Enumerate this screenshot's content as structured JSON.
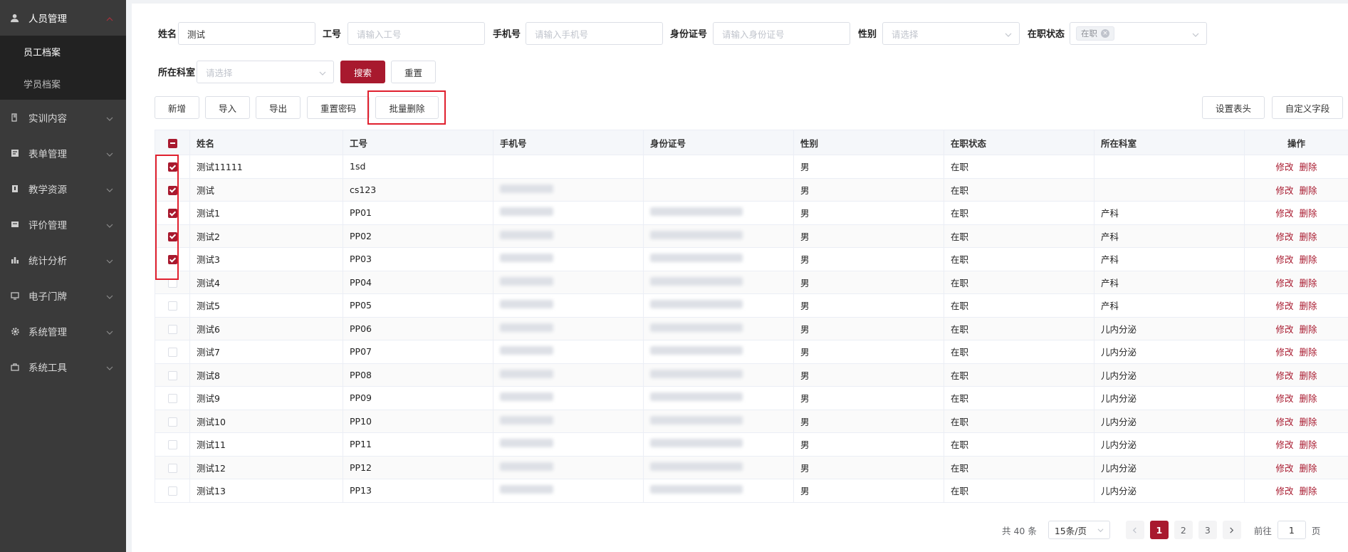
{
  "sidebar": {
    "groups": [
      {
        "label": "人员管理",
        "icon": "user-icon",
        "expanded": true
      },
      {
        "label": "实训内容",
        "icon": "book-icon"
      },
      {
        "label": "表单管理",
        "icon": "form-icon"
      },
      {
        "label": "教学资源",
        "icon": "resource-icon"
      },
      {
        "label": "评价管理",
        "icon": "evaluation-icon"
      },
      {
        "label": "统计分析",
        "icon": "bar-chart-icon"
      },
      {
        "label": "电子门牌",
        "icon": "monitor-icon"
      },
      {
        "label": "系统管理",
        "icon": "gear-icon"
      },
      {
        "label": "系统工具",
        "icon": "toolbox-icon"
      }
    ],
    "sub_items": [
      {
        "label": "员工档案",
        "active": true
      },
      {
        "label": "学员档案",
        "active": false
      }
    ]
  },
  "filters": {
    "name_label": "姓名",
    "name_value": "测试",
    "id_label": "工号",
    "id_placeholder": "请输入工号",
    "phone_label": "手机号",
    "phone_placeholder": "请输入手机号",
    "idcard_label": "身份证号",
    "idcard_placeholder": "请输入身份证号",
    "gender_label": "性别",
    "gender_placeholder": "请选择",
    "status_label": "在职状态",
    "status_tag": "在职",
    "dept_label": "所在科室",
    "dept_placeholder": "请选择",
    "search_label": "搜索",
    "reset_label": "重置"
  },
  "toolbar": {
    "add": "新增",
    "import": "导入",
    "export": "导出",
    "reset_password": "重置密码",
    "batch_delete": "批量删除",
    "set_header": "设置表头",
    "custom_fields": "自定义字段"
  },
  "table": {
    "columns": [
      "姓名",
      "工号",
      "手机号",
      "身份证号",
      "性别",
      "在职状态",
      "所在科室",
      "操作"
    ],
    "edit_label": "修改",
    "delete_label": "删除",
    "rows": [
      {
        "checked": true,
        "name": "测试11111",
        "id": "1sd",
        "phone": "",
        "idcard": "",
        "gender": "男",
        "status": "在职",
        "dept": ""
      },
      {
        "checked": true,
        "name": "测试",
        "id": "cs123",
        "phone": "blurred",
        "idcard": "",
        "gender": "男",
        "status": "在职",
        "dept": ""
      },
      {
        "checked": true,
        "name": "测试1",
        "id": "PP01",
        "phone": "blurred",
        "idcard": "blurred",
        "gender": "男",
        "status": "在职",
        "dept": "产科"
      },
      {
        "checked": true,
        "name": "测试2",
        "id": "PP02",
        "phone": "blurred",
        "idcard": "blurred",
        "gender": "男",
        "status": "在职",
        "dept": "产科"
      },
      {
        "checked": true,
        "name": "测试3",
        "id": "PP03",
        "phone": "blurred",
        "idcard": "blurred",
        "gender": "男",
        "status": "在职",
        "dept": "产科"
      },
      {
        "checked": false,
        "name": "测试4",
        "id": "PP04",
        "phone": "blurred",
        "idcard": "blurred",
        "gender": "男",
        "status": "在职",
        "dept": "产科"
      },
      {
        "checked": false,
        "name": "测试5",
        "id": "PP05",
        "phone": "blurred",
        "idcard": "blurred",
        "gender": "男",
        "status": "在职",
        "dept": "产科"
      },
      {
        "checked": false,
        "name": "测试6",
        "id": "PP06",
        "phone": "blurred",
        "idcard": "blurred",
        "gender": "男",
        "status": "在职",
        "dept": "儿内分泌"
      },
      {
        "checked": false,
        "name": "测试7",
        "id": "PP07",
        "phone": "blurred",
        "idcard": "blurred",
        "gender": "男",
        "status": "在职",
        "dept": "儿内分泌"
      },
      {
        "checked": false,
        "name": "测试8",
        "id": "PP08",
        "phone": "blurred",
        "idcard": "blurred",
        "gender": "男",
        "status": "在职",
        "dept": "儿内分泌"
      },
      {
        "checked": false,
        "name": "测试9",
        "id": "PP09",
        "phone": "blurred",
        "idcard": "blurred",
        "gender": "男",
        "status": "在职",
        "dept": "儿内分泌"
      },
      {
        "checked": false,
        "name": "测试10",
        "id": "PP10",
        "phone": "blurred",
        "idcard": "blurred",
        "gender": "男",
        "status": "在职",
        "dept": "儿内分泌"
      },
      {
        "checked": false,
        "name": "测试11",
        "id": "PP11",
        "phone": "blurred",
        "idcard": "blurred",
        "gender": "男",
        "status": "在职",
        "dept": "儿内分泌"
      },
      {
        "checked": false,
        "name": "测试12",
        "id": "PP12",
        "phone": "blurred",
        "idcard": "blurred",
        "gender": "男",
        "status": "在职",
        "dept": "儿内分泌"
      },
      {
        "checked": false,
        "name": "测试13",
        "id": "PP13",
        "phone": "blurred",
        "idcard": "blurred",
        "gender": "男",
        "status": "在职",
        "dept": "儿内分泌"
      }
    ]
  },
  "pagination": {
    "total_text": "共 40 条",
    "page_size": "15条/页",
    "pages": [
      "1",
      "2",
      "3"
    ],
    "current": "1",
    "goto_prefix": "前往",
    "goto_value": "1",
    "goto_suffix": "页"
  },
  "colors": {
    "accent": "#a8192e",
    "highlight_box": "#e0202e",
    "sidebar_bg": "#3a3a3a",
    "submenu_bg": "#222222"
  }
}
